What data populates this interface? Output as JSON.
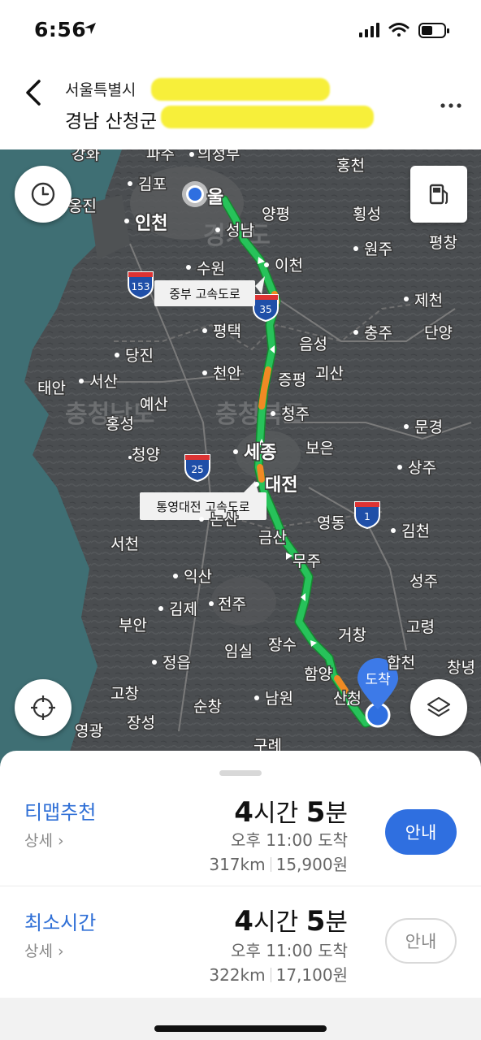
{
  "status_bar": {
    "time": "6:56",
    "location_icon": "location-arrow-icon",
    "signal_icon": "cellular-signal-icon",
    "wifi_icon": "wifi-icon",
    "battery_icon": "battery-icon"
  },
  "header": {
    "from": "서울특별시",
    "to": "경남 산청군",
    "back_icon": "chevron-left-icon",
    "more_icon": "more-dots-icon",
    "redact_color": "#f7ef3a"
  },
  "map": {
    "history_icon": "clock-icon",
    "fuel_icon": "gas-pump-icon",
    "locate_icon": "crosshair-icon",
    "layers_icon": "layers-icon",
    "route_color": "#27c25a",
    "traffic_color": "#f08a24",
    "destination_label": "도착",
    "highway_labels": [
      "중부 고속도로",
      "통영대전 고속도로"
    ],
    "shields": [
      "153",
      "35",
      "25",
      "1"
    ],
    "places": {
      "seoul": "울",
      "uijeongbu": "의정부",
      "paju": "파주",
      "ganghwa": "강화",
      "gimpo": "김포",
      "ongjin": "옹진",
      "incheon": "인천",
      "seongnam": "성남",
      "yangpyeong": "양평",
      "hongcheon": "홍천",
      "hoengseong": "횡성",
      "pyeongchang": "평창",
      "wonju": "원주",
      "suwon": "수원",
      "icheon": "이천",
      "jecheon": "제천",
      "pyeongtaek": "평택",
      "eumseong": "음성",
      "chungju": "충주",
      "danyang": "단양",
      "dangjin": "당진",
      "cheonan": "천안",
      "goesan": "괴산",
      "jeungpyeong": "증평",
      "taean": "태안",
      "seosan": "서산",
      "yesan": "예산",
      "hongseong": "홍성",
      "cheongju": "청주",
      "mungyeong": "문경",
      "cheongyang": "청양",
      "sejong": "세종",
      "boeun": "보은",
      "sangju": "상주",
      "daejeon": "대전",
      "nonsan": "논산",
      "yeongdong": "영동",
      "gimcheon": "김천",
      "geumsan": "금산",
      "seocheon": "서천",
      "muju": "무주",
      "iksan": "익산",
      "seongju": "성주",
      "gimje": "김제",
      "jeonju": "전주",
      "buan": "부안",
      "geochang": "거창",
      "goryeong": "고령",
      "imsil": "임실",
      "jangsu": "장수",
      "hapcheon": "합천",
      "changnyeong": "창녕",
      "jeongeup": "정읍",
      "hamyang": "함양",
      "gochang": "고창",
      "namwon": "남원",
      "sancheong": "산청",
      "sunchang": "순창",
      "yeonggwang": "영광",
      "jangseong": "장성",
      "gurye": "구례",
      "gyeonggi_region": "경기도",
      "chungnam_region": "충청남도",
      "chungbuk_region": "충청북도"
    }
  },
  "routes": [
    {
      "name": "티맵추천",
      "detail": "상세",
      "time_h": "4",
      "time_h_unit": "시간",
      "time_m": "5",
      "time_m_unit": "분",
      "arrival": "오후 11:00 도착",
      "distance": "317km",
      "fare": "15,900원",
      "button": "안내",
      "selected": true
    },
    {
      "name": "최소시간",
      "detail": "상세",
      "time_h": "4",
      "time_h_unit": "시간",
      "time_m": "5",
      "time_m_unit": "분",
      "arrival": "오후 11:00 도착",
      "distance": "322km",
      "fare": "17,100원",
      "button": "안내",
      "selected": false
    }
  ]
}
